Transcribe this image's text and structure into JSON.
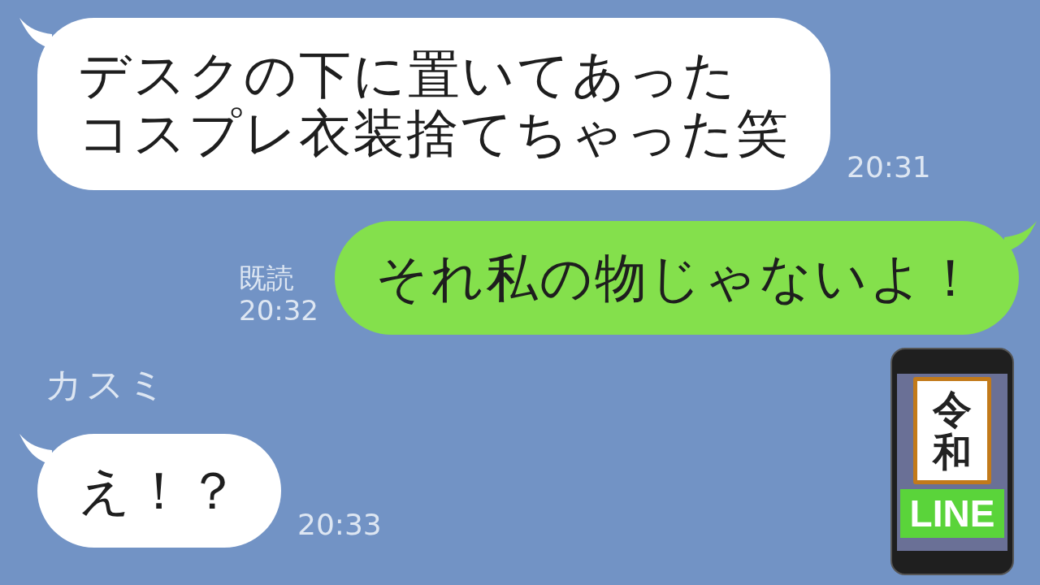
{
  "messages": [
    {
      "kind": "incoming",
      "lines": [
        "デスクの下に置いてあった",
        "コスプレ衣装捨てちゃった笑"
      ],
      "time": "20:31"
    },
    {
      "kind": "outgoing",
      "lines": [
        "それ私の物じゃないよ！"
      ],
      "read": "既読",
      "time": "20:32"
    },
    {
      "kind": "sender",
      "name": "カスミ"
    },
    {
      "kind": "incoming",
      "lines": [
        "え！？"
      ],
      "time": "20:33"
    }
  ],
  "badge": {
    "era": "令和",
    "app": "LINE"
  }
}
